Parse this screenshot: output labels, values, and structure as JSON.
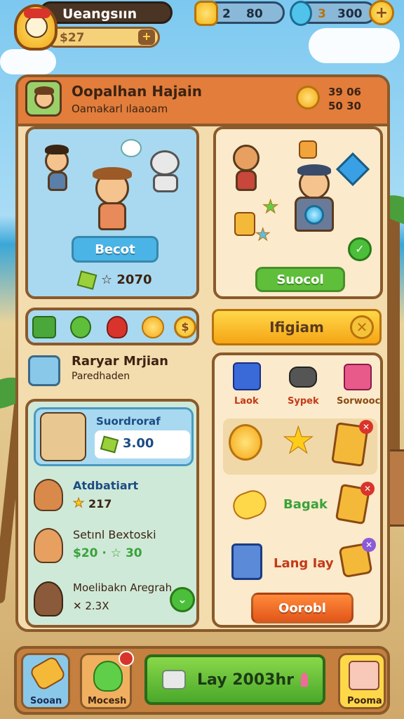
{
  "top_bar": {
    "player_name": "Ueangsıın",
    "currency_small": "$27",
    "resource_a_label": "2",
    "resource_a_value": "80",
    "resource_b_label": "3",
    "resource_b_value": "300",
    "add_symbol": "+"
  },
  "panel": {
    "title": "Oopalhan Hajain",
    "subtitle": "Oamakarl ılaaoam",
    "stats_line1": "39 06",
    "stats_line2": "50 30"
  },
  "card_left": {
    "button_label": "Becot",
    "price_text": "☆ 2070"
  },
  "card_right": {
    "button_label": "Suocol"
  },
  "wide_button": {
    "label": "Ifigiam"
  },
  "section2": {
    "title": "Raryar Mrjian",
    "subtitle": "Paredhaden"
  },
  "highlight": {
    "title": "Suordroraf",
    "value": "3.00"
  },
  "quest_list": [
    {
      "title": "Atdbatiart",
      "line": "217"
    },
    {
      "title": "Setınl Bextoski",
      "line": "$20 · ☆ 30"
    },
    {
      "title": "Moelibakn Aregrah",
      "line": "✕ 2.3X"
    }
  ],
  "shop": {
    "tabs": [
      "Laok",
      "Sypek",
      "Sorwooc"
    ],
    "row2_label": "Bagak",
    "row3_label": "Lang Iay",
    "cancel_label": "Oorobl"
  },
  "bottom": {
    "slot1": "Sooan",
    "slot2": "Mocesh",
    "play_label": "Lay 2003hr",
    "slot4": "Pooma"
  },
  "colors": {
    "panel_bg": "#f3dcae",
    "header_orange": "#e27d3c",
    "button_blue": "#4bb4e6",
    "button_green": "#5fbf3a",
    "button_yellow": "#f8c21a",
    "button_orange": "#f07a2a"
  }
}
